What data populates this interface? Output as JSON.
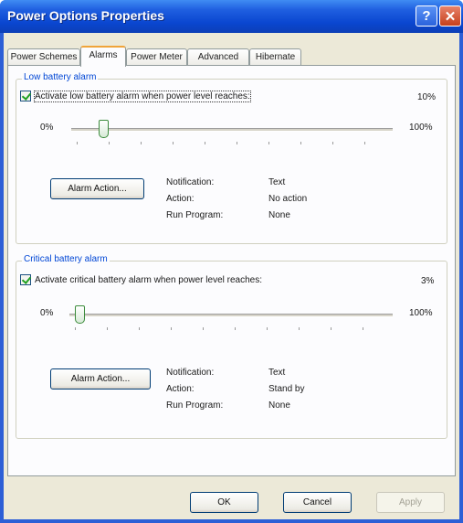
{
  "window": {
    "title": "Power Options Properties",
    "help_glyph": "?",
    "close_glyph": "✕"
  },
  "tabs": [
    {
      "label": "Power Schemes"
    },
    {
      "label": "Alarms"
    },
    {
      "label": "Power Meter"
    },
    {
      "label": "Advanced"
    },
    {
      "label": "Hibernate"
    }
  ],
  "low_alarm": {
    "group_label": "Low battery alarm",
    "checkbox_label": "Activate low battery alarm when power level reaches:",
    "checked": true,
    "level_value": "10%",
    "level_fraction": 0.1,
    "min_label": "0%",
    "max_label": "100%",
    "action_button": "Alarm Action...",
    "notification_label": "Notification:",
    "notification_value": "Text",
    "action_label": "Action:",
    "action_value": "No action",
    "program_label": "Run Program:",
    "program_value": "None"
  },
  "critical_alarm": {
    "group_label": "Critical battery alarm",
    "checkbox_label": "Activate critical battery alarm when power level reaches:",
    "checked": true,
    "level_value": "3%",
    "level_fraction": 0.03,
    "min_label": "0%",
    "max_label": "100%",
    "action_button": "Alarm Action...",
    "notification_label": "Notification:",
    "notification_value": "Text",
    "action_label": "Action:",
    "action_value": "Stand by",
    "program_label": "Run Program:",
    "program_value": "None"
  },
  "footer": {
    "ok": "OK",
    "cancel": "Cancel",
    "apply": "Apply"
  }
}
